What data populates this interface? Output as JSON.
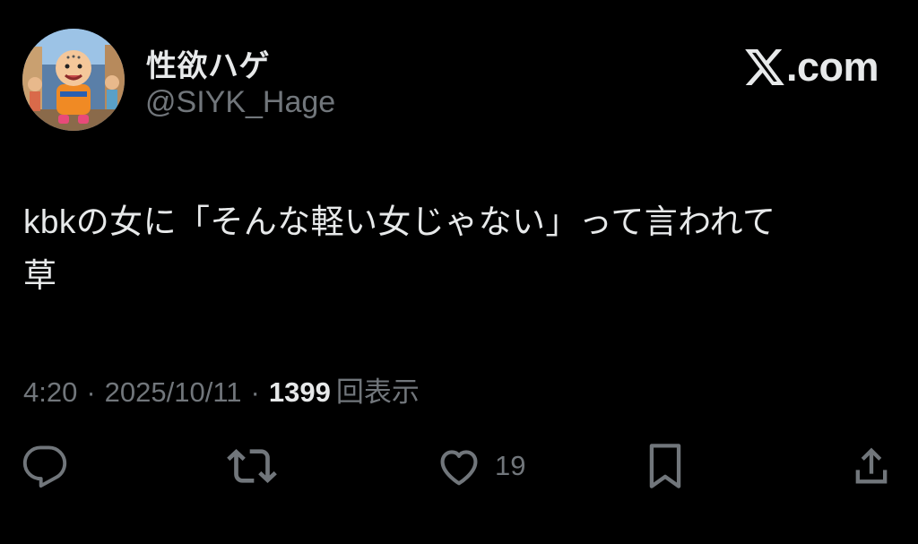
{
  "author": {
    "display_name": "性欲ハゲ",
    "handle": "@SIYK_Hage",
    "avatar_icon": "avatar-image"
  },
  "source_badge": {
    "logo_icon": "x-logo-icon",
    "domain": ".com"
  },
  "tweet": {
    "text": "kbkの女に「そんな軽い女じゃない」って言われて\n草"
  },
  "meta": {
    "time": "4:20",
    "separator": "·",
    "date": "2025/10/11",
    "views_count": "1399",
    "views_label": "回表示"
  },
  "actions": {
    "reply_icon": "reply-icon",
    "repost_icon": "repost-icon",
    "like_icon": "heart-icon",
    "like_count": "19",
    "bookmark_icon": "bookmark-icon",
    "share_icon": "share-icon"
  },
  "colors": {
    "background": "#000000",
    "primary_text": "#e7e9ea",
    "secondary_text": "#71767b"
  }
}
